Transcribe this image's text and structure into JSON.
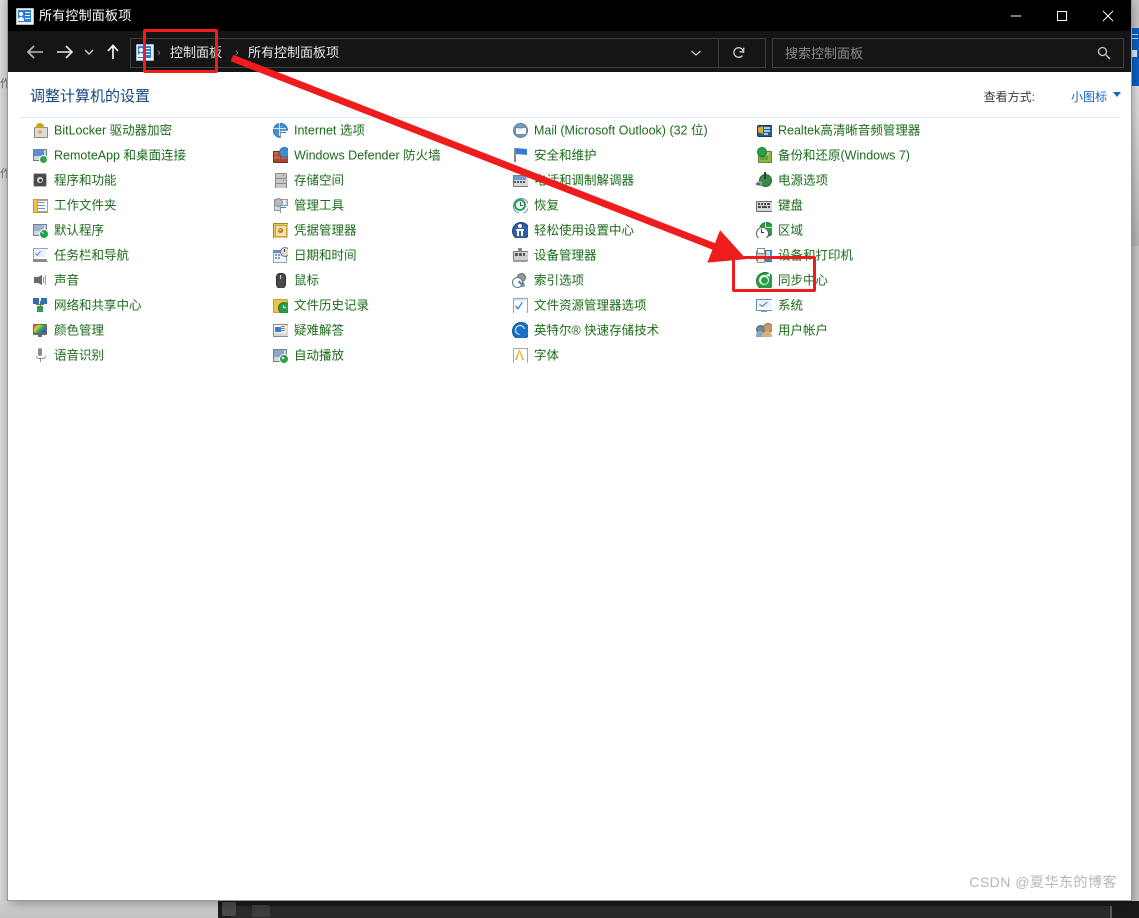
{
  "window": {
    "title": "所有控制面板项",
    "title_icon": "control-panel-icon",
    "minimize_label": "最小化",
    "maximize_label": "最大化",
    "close_label": "关闭"
  },
  "addressbar": {
    "back_label": "后退",
    "forward_label": "前进",
    "recent_label": "最近浏览的位置",
    "up_label": "上移到",
    "separator": "›",
    "crumbs": [
      "控制面板",
      "所有控制面板项"
    ],
    "dropdown_label": "以前的位置",
    "refresh_label": "刷新",
    "search": {
      "placeholder": "搜索控制面板",
      "value": ""
    }
  },
  "content": {
    "page_title": "调整计算机的设置",
    "view_by_label": "查看方式:",
    "view_by_value": "小图标"
  },
  "items": {
    "columns": [
      [
        {
          "label": "BitLocker 驱动器加密",
          "icon": "bitlocker-icon"
        },
        {
          "label": "RemoteApp 和桌面连接",
          "icon": "remoteapp-icon"
        },
        {
          "label": "程序和功能",
          "icon": "programs-features-icon"
        },
        {
          "label": "工作文件夹",
          "icon": "work-folders-icon"
        },
        {
          "label": "默认程序",
          "icon": "default-programs-icon"
        },
        {
          "label": "任务栏和导航",
          "icon": "taskbar-navigation-icon"
        },
        {
          "label": "声音",
          "icon": "sound-icon"
        },
        {
          "label": "网络和共享中心",
          "icon": "network-sharing-icon"
        },
        {
          "label": "颜色管理",
          "icon": "color-management-icon"
        },
        {
          "label": "语音识别",
          "icon": "speech-recognition-icon"
        }
      ],
      [
        {
          "label": "Internet 选项",
          "icon": "internet-options-icon"
        },
        {
          "label": "Windows Defender 防火墙",
          "icon": "firewall-icon"
        },
        {
          "label": "存储空间",
          "icon": "storage-spaces-icon"
        },
        {
          "label": "管理工具",
          "icon": "administrative-tools-icon"
        },
        {
          "label": "凭据管理器",
          "icon": "credential-manager-icon"
        },
        {
          "label": "日期和时间",
          "icon": "date-time-icon"
        },
        {
          "label": "鼠标",
          "icon": "mouse-icon"
        },
        {
          "label": "文件历史记录",
          "icon": "file-history-icon"
        },
        {
          "label": "疑难解答",
          "icon": "troubleshooting-icon"
        },
        {
          "label": "自动播放",
          "icon": "autoplay-icon"
        }
      ],
      [
        {
          "label": "Mail (Microsoft Outlook) (32 位)",
          "icon": "mail-icon"
        },
        {
          "label": "安全和维护",
          "icon": "security-maintenance-icon"
        },
        {
          "label": "电话和调制解调器",
          "icon": "phone-modem-icon"
        },
        {
          "label": "恢复",
          "icon": "recovery-icon"
        },
        {
          "label": "轻松使用设置中心",
          "icon": "ease-of-access-icon"
        },
        {
          "label": "设备管理器",
          "icon": "device-manager-icon"
        },
        {
          "label": "索引选项",
          "icon": "indexing-options-icon"
        },
        {
          "label": "文件资源管理器选项",
          "icon": "file-explorer-options-icon"
        },
        {
          "label": "英特尔® 快速存储技术",
          "icon": "intel-rst-icon"
        },
        {
          "label": "字体",
          "icon": "fonts-icon"
        }
      ],
      [
        {
          "label": "Realtek高清晰音频管理器",
          "icon": "realtek-audio-icon"
        },
        {
          "label": "备份和还原(Windows 7)",
          "icon": "backup-restore-icon"
        },
        {
          "label": "电源选项",
          "icon": "power-options-icon"
        },
        {
          "label": "键盘",
          "icon": "keyboard-icon"
        },
        {
          "label": "区域",
          "icon": "region-icon"
        },
        {
          "label": "设备和打印机",
          "icon": "devices-printers-icon"
        },
        {
          "label": "同步中心",
          "icon": "sync-center-icon"
        },
        {
          "label": "系统",
          "icon": "system-icon"
        },
        {
          "label": "用户帐户",
          "icon": "user-accounts-icon"
        }
      ]
    ]
  },
  "annotations": {
    "highlight_color": "#ee1c1c",
    "boxes": [
      {
        "name": "控制面板",
        "target": "breadcrumb-control-panel"
      },
      {
        "name": "区域",
        "target": "item-region"
      }
    ],
    "arrow": {
      "from": "breadcrumb-control-panel",
      "to": "item-region"
    }
  },
  "watermark": {
    "text": "CSDN @夏华东的博客"
  },
  "background": {
    "left_label_1": "作",
    "left_label_2": "作"
  }
}
